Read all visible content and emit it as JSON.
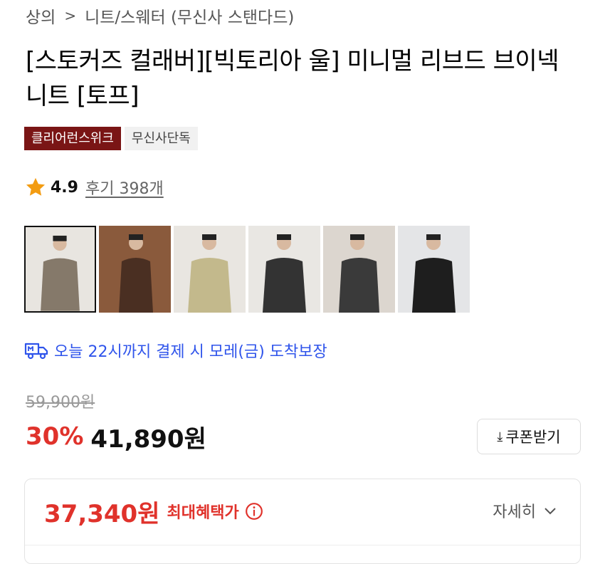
{
  "breadcrumb": {
    "category": "상의",
    "separator": ">",
    "subcategory": "니트/스웨터 (무신사 스탠다드)"
  },
  "product": {
    "title": "[스토커즈 컬래버][빅토리아 울] 미니멀 리브드 브이넥 니트 [토프]",
    "badges": {
      "brand": "클리어런스위크",
      "exclusive": "무신사단독"
    },
    "rating": {
      "score": "4.9",
      "reviews": "후기 398개"
    }
  },
  "thumbnails": [
    {
      "alt": "토프 색상 정면 착용 이미지",
      "sweater": "#85796a",
      "bg": "#e8e5e0"
    },
    {
      "alt": "브라운 색상 착용 이미지",
      "sweater": "#4a2f22",
      "bg": "#8a5a3c"
    },
    {
      "alt": "베이지 색상 착용 이미지",
      "sweater": "#c3b98c",
      "bg": "#e9e6e1"
    },
    {
      "alt": "차콜 색상 착용 이미지",
      "sweater": "#333333",
      "bg": "#e9e7e3"
    },
    {
      "alt": "그레이 색상 착용 이미지",
      "sweater": "#3a3a3a",
      "bg": "#dcd6cf"
    },
    {
      "alt": "블랙 색상 착용 이미지",
      "sweater": "#1e1e1e",
      "bg": "#e4e5e7"
    }
  ],
  "delivery": {
    "text": "오늘 22시까지 결제 시 모레(금) 도착보장",
    "icon": "delivery-truck-icon",
    "color": "#2f54eb"
  },
  "price": {
    "original": "59,900원",
    "discount": "30%",
    "sale": "41,890원",
    "coupon_label": "쿠폰받기",
    "discount_color": "#e0322b"
  },
  "benefit": {
    "max_price": "37,340원",
    "label": "최대혜택가",
    "details_label": "자세히"
  },
  "colors": {
    "brand_badge": "#7a1515",
    "accent_red": "#e0322b",
    "link_blue": "#2f54eb"
  }
}
